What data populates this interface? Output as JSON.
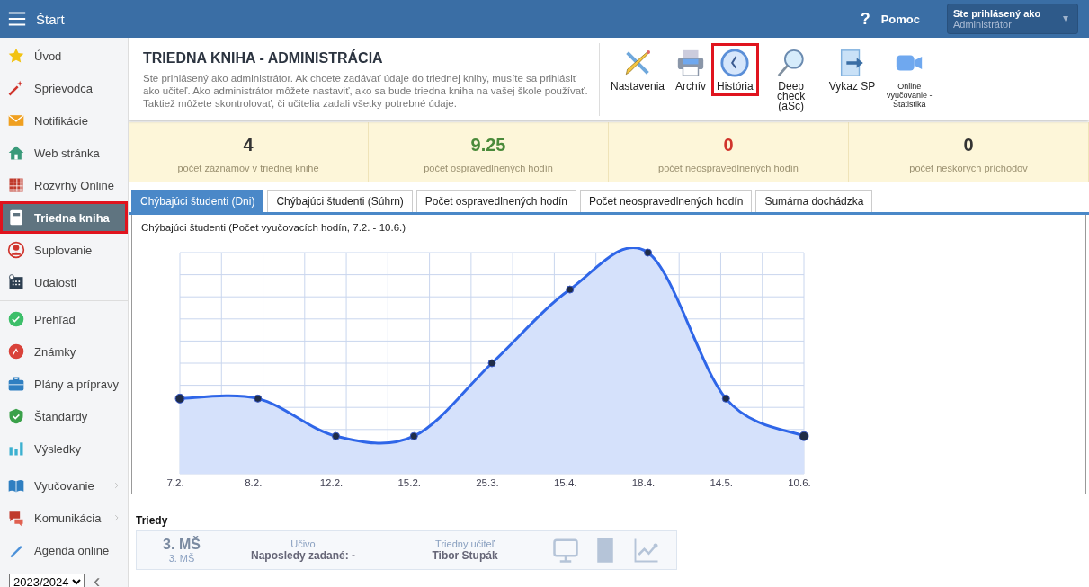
{
  "topbar": {
    "title": "Štart",
    "help_icon": "?",
    "help": "Pomoc",
    "user_label": "Ste prihlásený ako",
    "user_role": "Administrátor"
  },
  "sidebar": {
    "groups": [
      {
        "items": [
          {
            "label": "Úvod",
            "selected": false,
            "highlighted": false
          },
          {
            "label": "Sprievodca",
            "selected": false,
            "highlighted": false
          },
          {
            "label": "Notifikácie",
            "selected": false,
            "highlighted": false
          },
          {
            "label": "Web stránka",
            "selected": false,
            "highlighted": false
          },
          {
            "label": "Rozvrhy Online",
            "selected": false,
            "highlighted": false
          },
          {
            "label": "Triedna kniha",
            "selected": true,
            "highlighted": true
          },
          {
            "label": "Suplovanie",
            "selected": false,
            "highlighted": false
          },
          {
            "label": "Udalosti",
            "selected": false,
            "highlighted": false
          }
        ]
      },
      {
        "items": [
          {
            "label": "Prehľad",
            "selected": false,
            "highlighted": false
          },
          {
            "label": "Známky",
            "selected": false,
            "highlighted": false
          },
          {
            "label": "Plány a prípravy",
            "selected": false,
            "highlighted": false
          },
          {
            "label": "Štandardy",
            "selected": false,
            "highlighted": false
          },
          {
            "label": "Výsledky",
            "selected": false,
            "highlighted": false
          }
        ]
      },
      {
        "items": [
          {
            "label": "Vyučovanie",
            "selected": false,
            "highlighted": false,
            "expandable": true
          },
          {
            "label": "Komunikácia",
            "selected": false,
            "highlighted": false,
            "expandable": true
          },
          {
            "label": "Agenda online",
            "selected": false,
            "highlighted": false,
            "expandable": false
          }
        ]
      }
    ],
    "year": "2023/2024",
    "collapse": "‹"
  },
  "header": {
    "title": "TRIEDNA KNIHA - ADMINISTRÁCIA",
    "description": "Ste prihlásený ako administrátor. Ak chcete zadávať údaje do triednej knihy, musíte sa prihlásiť ako učiteľ. Ako administrátor môžete nastaviť, ako sa bude triedna kniha na vašej škole používať. Taktiež môžete skontrolovať, či učitelia zadali všetky potrebné údaje."
  },
  "toolbar": [
    {
      "label": "Nastavenia",
      "highlighted": false,
      "small": false
    },
    {
      "label": "Archív",
      "highlighted": false,
      "small": false
    },
    {
      "label": "História",
      "highlighted": true,
      "small": false
    },
    {
      "label": "Deep check (aSc)",
      "highlighted": false,
      "small": false
    },
    {
      "label": "Vykaz SP",
      "highlighted": false,
      "small": false
    },
    {
      "label": "Online vyučovanie - Štatistika",
      "highlighted": false,
      "small": true
    }
  ],
  "stats": [
    {
      "value": "4",
      "label": "počet záznamov v triednej knihe",
      "color": "#333333"
    },
    {
      "value": "9.25",
      "label": "počet ospravedlnených hodín",
      "color": "#4a8a3a"
    },
    {
      "value": "0",
      "label": "počet neospravedlnených hodín",
      "color": "#d0342c"
    },
    {
      "value": "0",
      "label": "počet neskorých príchodov",
      "color": "#333333"
    }
  ],
  "tabs": [
    {
      "label": "Chýbajúci študenti (Dni)",
      "selected": true
    },
    {
      "label": "Chýbajúci študenti (Súhrn)",
      "selected": false
    },
    {
      "label": "Počet ospravedlnených hodín",
      "selected": false
    },
    {
      "label": "Počet neospravedlnených hodín",
      "selected": false
    },
    {
      "label": "Sumárna dochádzka",
      "selected": false
    }
  ],
  "chart": {
    "title": "Chýbajúci študenti (Počet vyučovacích hodín, 7.2. - 10.6.)",
    "x_labels": [
      "7.2.",
      "8.2.",
      "12.2.",
      "15.2.",
      "25.3.",
      "15.4.",
      "18.4.",
      "14.5.",
      "10.6."
    ]
  },
  "classes": {
    "heading": "Triedy",
    "cards": [
      {
        "name": "3. MŠ",
        "subname": "3. MŠ",
        "topic_label": "Učivo",
        "topic_value": "Naposledy zadané: -",
        "teacher_label": "Triedny učiteľ",
        "teacher_value": "Tibor Stupák"
      }
    ]
  }
}
